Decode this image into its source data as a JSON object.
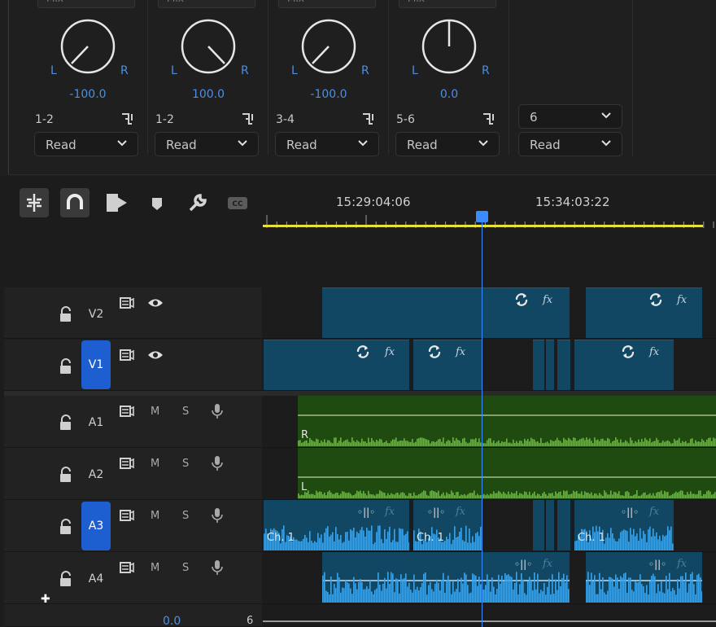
{
  "mixer": {
    "channels": [
      {
        "mode_top": "Mix",
        "pan_value": "-100.0",
        "left": "L",
        "right": "R",
        "channel_id": "1-2",
        "automation": "Read"
      },
      {
        "mode_top": "Mix",
        "pan_value": "100.0",
        "left": "L",
        "right": "R",
        "channel_id": "1-2",
        "automation": "Read"
      },
      {
        "mode_top": "Mix",
        "pan_value": "-100.0",
        "left": "L",
        "right": "R",
        "channel_id": "3-4",
        "automation": "Read"
      },
      {
        "mode_top": "Mix",
        "pan_value": "0.0",
        "left": "L",
        "right": "R",
        "channel_id": "5-6",
        "automation": "Read"
      }
    ],
    "master": {
      "channels": "6",
      "automation": "Read"
    },
    "colors": {
      "accent": "#4e8fe0"
    }
  },
  "timeline": {
    "timecode_1": "15:29:04:06",
    "timecode_2": "15:34:03:22",
    "tools": [
      "snap-in-timeline-icon",
      "linked-selection-icon",
      "insert-multicam-icon",
      "add-marker-icon",
      "wrench-icon",
      "captions-icon"
    ],
    "tracks": {
      "V2": {
        "name": "V2"
      },
      "V1": {
        "name": "V1"
      },
      "A1": {
        "name": "A1",
        "m": "M",
        "s": "S",
        "channel_letter": "R"
      },
      "A2": {
        "name": "A2",
        "m": "M",
        "s": "S",
        "channel_letter": "L"
      },
      "A3": {
        "name": "A3",
        "m": "M",
        "s": "S",
        "clip_label": "Ch. 1"
      },
      "A4": {
        "name": "A4",
        "m": "M",
        "s": "S"
      }
    },
    "fx_label": "fx",
    "bottom_value": "0.0",
    "bottom_right": "6"
  }
}
